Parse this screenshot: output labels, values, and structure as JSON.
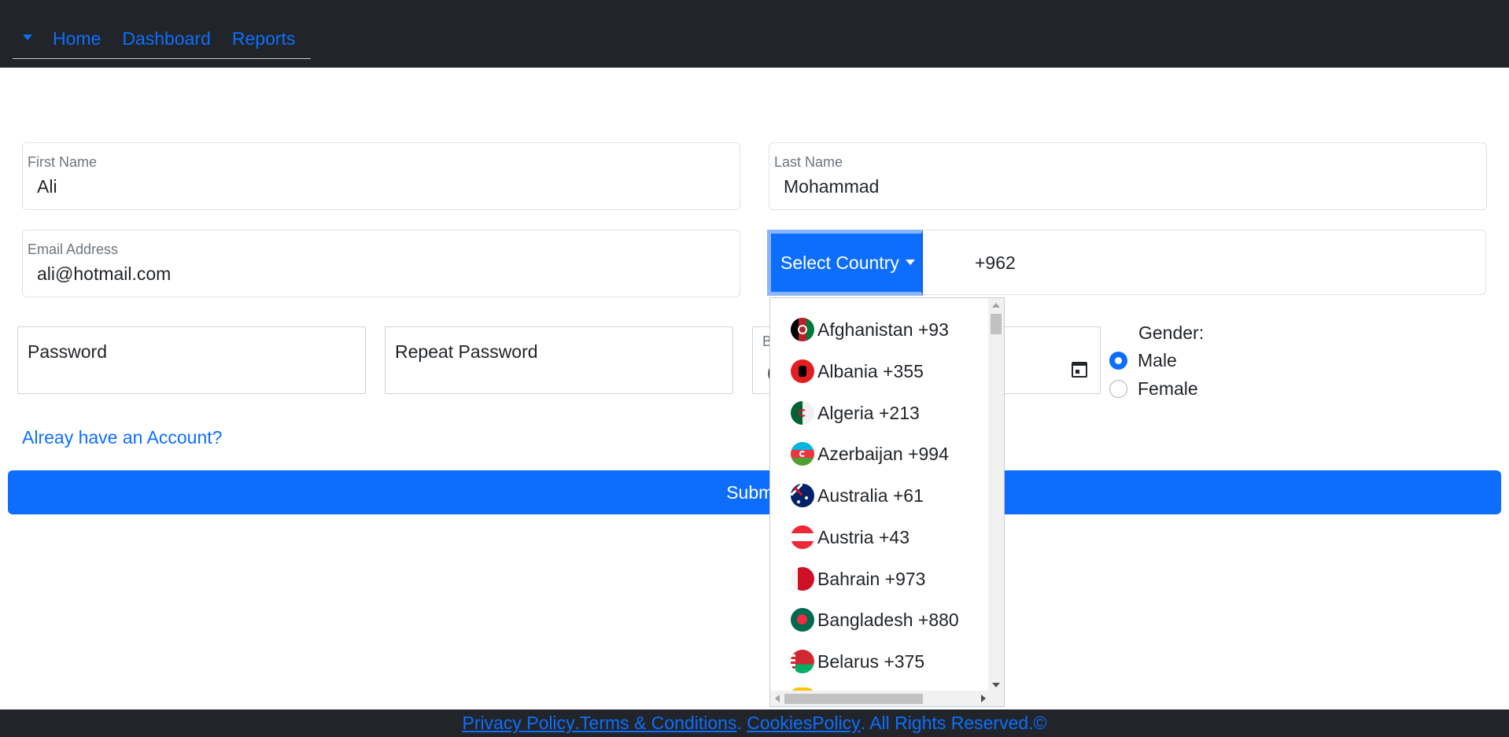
{
  "nav": {
    "links": [
      "Home",
      "Dashboard",
      "Reports"
    ]
  },
  "form": {
    "first_name": {
      "label": "First Name",
      "value": "Ali"
    },
    "last_name": {
      "label": "Last Name",
      "value": "Mohammad"
    },
    "email": {
      "label": "Email Address",
      "value": "ali@hotmail.com"
    },
    "country_button": "Select Country",
    "phone_value": "+962",
    "password_placeholder": "Password",
    "repeat_password_placeholder": "Repeat Password",
    "date_label_partial": "B",
    "date_value_partial": "(",
    "gender_label": "Gender:",
    "gender_options": [
      {
        "label": "Male",
        "checked": true
      },
      {
        "label": "Female",
        "checked": false
      }
    ],
    "account_link": "Alreay have an Account?",
    "submit_label": "Submit"
  },
  "country_dropdown": {
    "items": [
      {
        "name": "Afghanistan +93",
        "flag": "afghanistan-flag-icon"
      },
      {
        "name": "Albania +355",
        "flag": "albania-flag-icon"
      },
      {
        "name": "Algeria +213",
        "flag": "algeria-flag-icon"
      },
      {
        "name": "Azerbaijan +994",
        "flag": "azerbaijan-flag-icon"
      },
      {
        "name": "Australia +61",
        "flag": "australia-flag-icon"
      },
      {
        "name": "Austria +43",
        "flag": "austria-flag-icon"
      },
      {
        "name": "Bahrain +973",
        "flag": "bahrain-flag-icon"
      },
      {
        "name": "Bangladesh +880",
        "flag": "bangladesh-flag-icon"
      },
      {
        "name": "Belarus +375",
        "flag": "belarus-flag-icon"
      }
    ]
  },
  "footer": {
    "privacy": "Privacy Policy ",
    "dot1": ".",
    "terms": " Terms & Conditions",
    "dot2": ".",
    "cookies": "CookiesPolicy",
    "rights": ". All Rights Reserved.©"
  },
  "colors": {
    "navbar": "#212529",
    "primary": "#0d6efd",
    "link": "#0d6efd"
  }
}
